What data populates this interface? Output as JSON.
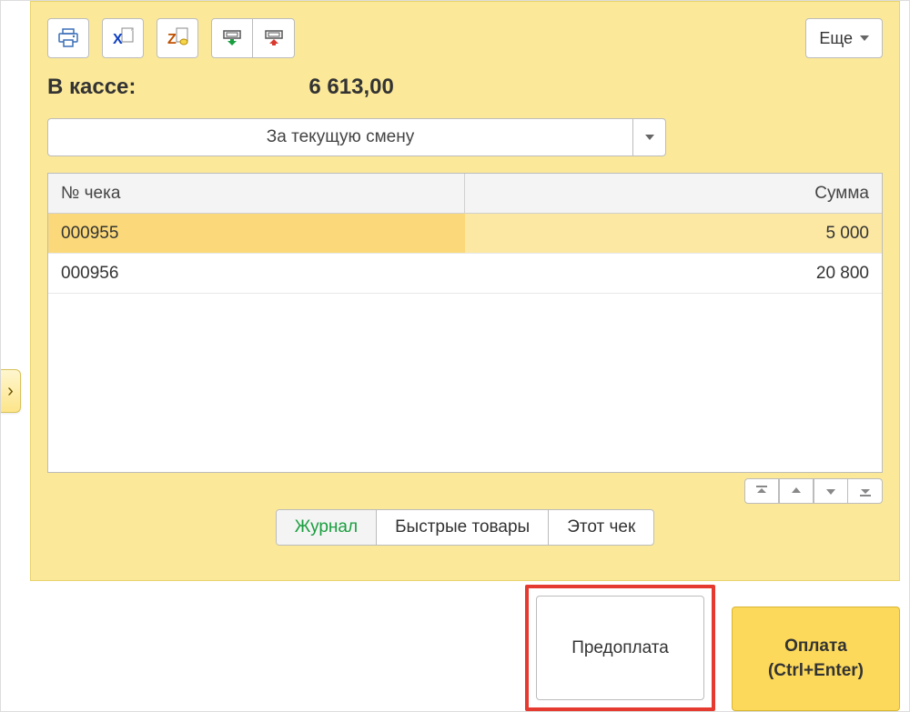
{
  "toolbar": {
    "more_label": "Еще"
  },
  "cash": {
    "label": "В кассе:",
    "value": "6 613,00"
  },
  "filter": {
    "selected": "За текущую смену"
  },
  "table": {
    "header_number": "№ чека",
    "header_sum": "Сумма",
    "rows": [
      {
        "number": "000955",
        "sum": "5 000",
        "selected": true
      },
      {
        "number": "000956",
        "sum": "20 800",
        "selected": false
      }
    ]
  },
  "tabs": {
    "journal": "Журнал",
    "quick_goods": "Быстрые товары",
    "this_receipt": "Этот чек"
  },
  "buttons": {
    "prepayment": "Предоплата",
    "payment_line1": "Оплата",
    "payment_line2": "(Ctrl+Enter)"
  }
}
